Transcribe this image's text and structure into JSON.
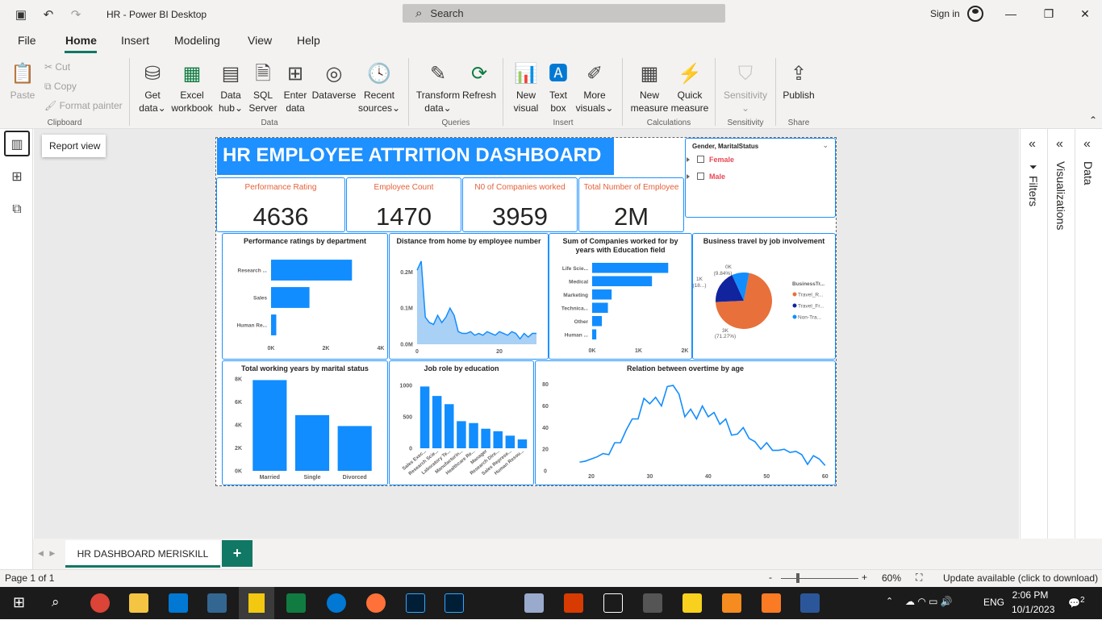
{
  "window": {
    "title": "HR - Power BI Desktop",
    "search_placeholder": "Search",
    "signin": "Sign in"
  },
  "menu": [
    "File",
    "Home",
    "Insert",
    "Modeling",
    "View",
    "Help"
  ],
  "ribbon": {
    "clipboard": {
      "paste": "Paste",
      "cut": "Cut",
      "copy": "Copy",
      "format_painter": "Format painter",
      "label": "Clipboard"
    },
    "data": {
      "get_data": "Get",
      "get_data2": "data",
      "excel": "Excel",
      "excel2": "workbook",
      "datahub": "Data",
      "datahub2": "hub",
      "sql": "SQL",
      "sql2": "Server",
      "enter": "Enter",
      "enter2": "data",
      "dataverse": "Dataverse",
      "recent": "Recent",
      "recent2": "sources",
      "label": "Data"
    },
    "queries": {
      "transform": "Transform",
      "transform2": "data",
      "refresh": "Refresh",
      "label": "Queries"
    },
    "insert": {
      "new_visual": "New",
      "new_visual2": "visual",
      "text_box": "Text",
      "text_box2": "box",
      "more_visuals": "More",
      "more_visuals2": "visuals",
      "label": "Insert"
    },
    "calculations": {
      "new_measure": "New",
      "new_measure2": "measure",
      "quick_measure": "Quick",
      "quick_measure2": "measure",
      "label": "Calculations"
    },
    "sensitivity": {
      "btn": "Sensitivity",
      "label": "Sensitivity"
    },
    "share": {
      "publish": "Publish",
      "label": "Share"
    }
  },
  "leftbar": {
    "tooltip": "Report view"
  },
  "dashboard": {
    "title": "HR EMPLOYEE ATTRITION DASHBOARD",
    "slicer": {
      "title": "Gender, MaritalStatus",
      "items": [
        "Female",
        "Male"
      ]
    },
    "kpis": [
      {
        "label": "Performance Rating",
        "value": "4636"
      },
      {
        "label": "Employee Count",
        "value": "1470"
      },
      {
        "label": "N0 of Companies worked",
        "value": "3959"
      },
      {
        "label": "Total Number of Employee",
        "value": "2M"
      }
    ],
    "visual_titles": {
      "perf": "Performance ratings by department",
      "dist": "Distance from home by employee number",
      "comp": "Sum of Companies worked for by years with Education field",
      "travel": "Business travel by job involvement",
      "marital": "Total working years by marital status",
      "jobrole": "Job role by education",
      "overtime": "Relation between overtime by age"
    }
  },
  "chart_data": [
    {
      "type": "bar",
      "orientation": "horizontal",
      "title": "Performance ratings by department",
      "categories": [
        "Research ...",
        "Sales",
        "Human Re..."
      ],
      "values": [
        2950,
        1400,
        190
      ],
      "xticks": [
        "0K",
        "2K",
        "4K"
      ],
      "xlim": [
        0,
        4000
      ]
    },
    {
      "type": "area",
      "title": "Distance from home by employee number",
      "x": [
        0,
        1,
        2,
        3,
        4,
        5,
        6,
        7,
        8,
        9,
        10,
        11,
        12,
        13,
        14,
        15,
        16,
        17,
        18,
        19,
        20,
        21,
        22,
        23,
        24,
        25,
        26,
        27,
        28,
        29
      ],
      "values": [
        0.205,
        0.23,
        0.075,
        0.06,
        0.055,
        0.08,
        0.06,
        0.075,
        0.1,
        0.08,
        0.035,
        0.03,
        0.03,
        0.035,
        0.025,
        0.03,
        0.025,
        0.035,
        0.03,
        0.025,
        0.035,
        0.03,
        0.025,
        0.035,
        0.03,
        0.015,
        0.03,
        0.02,
        0.03,
        0.03
      ],
      "yticks": [
        "0.0M",
        "0.1M",
        "0.2M"
      ],
      "ylim": [
        0,
        0.25
      ],
      "xticks": [
        "0",
        "20"
      ]
    },
    {
      "type": "bar",
      "orientation": "horizontal",
      "title": "Sum of Companies worked for by years with Education field",
      "categories": [
        "Life Scie...",
        "Medical",
        "Marketing",
        "Technica...",
        "Other",
        "Human ..."
      ],
      "values": [
        1640,
        1290,
        420,
        340,
        210,
        90
      ],
      "xticks": [
        "0K",
        "1K",
        "2K"
      ],
      "xlim": [
        0,
        2000
      ]
    },
    {
      "type": "pie",
      "title": "Business travel by job involvement",
      "legend_title": "BusinessTr...",
      "slices": [
        {
          "name": "Travel_R...",
          "value": 71.27,
          "color": "#e8703a"
        },
        {
          "name": "Travel_Fr...",
          "value": 18.89,
          "color": "#12239e"
        },
        {
          "name": "Non-Tra...",
          "value": 9.84,
          "color": "#118dff"
        }
      ],
      "labels": [
        "3K",
        "(71.27%)",
        "1K",
        "(18...)",
        "0K",
        "(9.84%)"
      ]
    },
    {
      "type": "bar",
      "title": "Total working years by marital status",
      "categories": [
        "Married",
        "Single",
        "Divorced"
      ],
      "values": [
        7900,
        4850,
        3900
      ],
      "yticks": [
        "0K",
        "2K",
        "4K",
        "6K",
        "8K"
      ],
      "ylim": [
        0,
        8000
      ]
    },
    {
      "type": "bar",
      "title": "Job role by education",
      "categories": [
        "Sales Exec...",
        "Research Scie...",
        "Laboratory Te...",
        "Manufacturin...",
        "Healthcare Re...",
        "Manager",
        "Research Dire...",
        "Sales Represe...",
        "Human Resou..."
      ],
      "values": [
        980,
        830,
        700,
        430,
        400,
        310,
        270,
        200,
        140
      ],
      "yticks": [
        "0",
        "500",
        "1000"
      ],
      "ylim": [
        0,
        1100
      ]
    },
    {
      "type": "line",
      "title": "Relation between overtime by age",
      "x": [
        18,
        19,
        20,
        21,
        22,
        23,
        24,
        25,
        26,
        27,
        28,
        29,
        30,
        31,
        32,
        33,
        34,
        35,
        36,
        37,
        38,
        39,
        40,
        41,
        42,
        43,
        44,
        45,
        46,
        47,
        48,
        49,
        50,
        51,
        52,
        53,
        54,
        55,
        56,
        57,
        58,
        59,
        60
      ],
      "values": [
        8,
        9,
        11,
        13,
        16,
        15,
        26,
        26,
        38,
        48,
        48,
        67,
        62,
        68,
        60,
        78,
        79,
        71,
        50,
        57,
        48,
        60,
        50,
        54,
        43,
        48,
        33,
        34,
        40,
        30,
        27,
        20,
        26,
        19,
        19,
        20,
        17,
        18,
        15,
        6,
        14,
        11,
        5
      ],
      "yticks": [
        "0",
        "20",
        "40",
        "60",
        "80"
      ],
      "xticks": [
        "20",
        "30",
        "40",
        "50",
        "60"
      ],
      "ylim": [
        0,
        85
      ],
      "xlim": [
        16,
        61
      ]
    }
  ],
  "rightpanes": {
    "filters": "Filters",
    "visualizations": "Visualizations",
    "data": "Data"
  },
  "pagetab": {
    "name": "HR DASHBOARD MERISKILL",
    "add": "+"
  },
  "statusbar": {
    "page": "Page 1 of 1",
    "zoom": "60%",
    "update": "Update available (click to download)"
  },
  "taskbar": {
    "lang": "ENG",
    "time": "2:06 PM",
    "date": "10/1/2023",
    "notif": "2"
  }
}
